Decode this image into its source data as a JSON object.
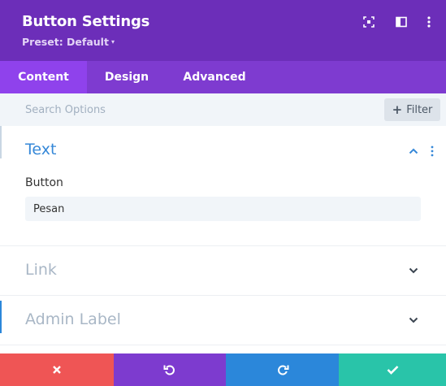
{
  "header": {
    "title": "Button Settings",
    "preset_label": "Preset: Default",
    "preset_caret": "▾",
    "icons": [
      "fullscreen-icon",
      "sidebar-toggle-icon",
      "more-options-icon"
    ]
  },
  "tabs": [
    {
      "label": "Content",
      "active": true
    },
    {
      "label": "Design",
      "active": false
    },
    {
      "label": "Advanced",
      "active": false
    }
  ],
  "search": {
    "placeholder": "Search Options",
    "filter_label": "Filter",
    "filter_icon": "plus-icon"
  },
  "sections": [
    {
      "title": "Text",
      "expanded": true,
      "fields": [
        {
          "label": "Button",
          "value": "Pesan"
        }
      ]
    },
    {
      "title": "Link",
      "expanded": false
    },
    {
      "title": "Admin Label",
      "expanded": false
    }
  ],
  "footer": {
    "buttons": [
      {
        "name": "cancel",
        "icon": "close-icon",
        "color": "#ef5555"
      },
      {
        "name": "undo",
        "icon": "undo-icon",
        "color": "#7d3bcf"
      },
      {
        "name": "redo",
        "icon": "redo-icon",
        "color": "#2b87da"
      },
      {
        "name": "save",
        "icon": "check-icon",
        "color": "#29c4a9"
      }
    ]
  },
  "colors": {
    "header_bg": "#6c2eb9",
    "tabs_bg": "#7e3bd0",
    "active_tab_bg": "#8f42ec",
    "accent_blue": "#3688d8"
  }
}
